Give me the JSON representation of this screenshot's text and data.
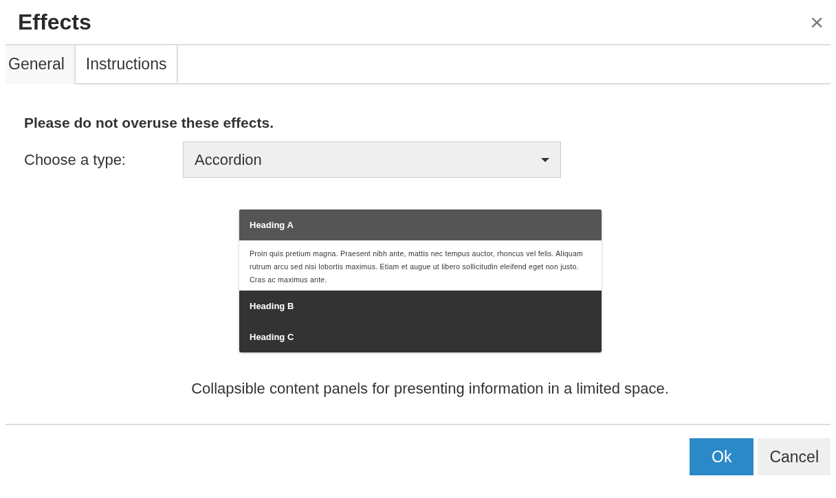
{
  "dialog": {
    "title": "Effects",
    "close": "×"
  },
  "tabs": [
    {
      "label": "General",
      "selected": true
    },
    {
      "label": "Instructions",
      "selected": false
    }
  ],
  "note": "Please do not overuse these effects.",
  "type_field": {
    "label": "Choose a type:",
    "value": "Accordion"
  },
  "preview": {
    "panels": [
      {
        "heading": "Heading A",
        "expanded": true,
        "body": "Proin quis pretium magna. Praesent nibh ante, mattis nec tempus auctor, rhoncus vel felis. Aliquam rutrum arcu sed nisi lobortis maximus. Etiam et augue ut libero sollicitudin eleifend eget non justo. Cras ac maximus ante."
      },
      {
        "heading": "Heading B",
        "expanded": false
      },
      {
        "heading": "Heading C",
        "expanded": false
      }
    ]
  },
  "description": "Collapsible content panels for presenting information in a limited space.",
  "buttons": [
    {
      "label": "Ok",
      "kind": "primary"
    },
    {
      "label": "Cancel",
      "kind": "default"
    }
  ]
}
